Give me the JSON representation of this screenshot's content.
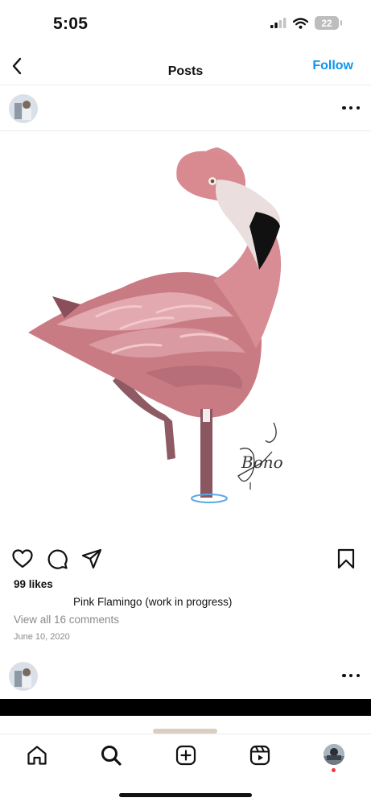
{
  "status_bar": {
    "time": "5:05",
    "battery_level": "22",
    "icons": [
      "cellular-signal-icon",
      "wifi-icon",
      "battery-icon"
    ]
  },
  "nav": {
    "back_icon": "chevron-left-icon",
    "title": "Posts",
    "follow_label": "Follow",
    "follow_color": "#0a95f0"
  },
  "post": {
    "author_avatar": "avatar",
    "more_icon": "more-horizontal-icon",
    "image_subject": "flamingo-painting",
    "signature": "Bono",
    "actions": [
      "heart-icon",
      "comment-icon",
      "share-icon",
      "bookmark-icon"
    ],
    "likes": "99 likes",
    "caption": "Pink Flamingo (work in progress)",
    "view_comments": "View all 16 comments",
    "date": "June 10, 2020"
  },
  "next_post": {
    "author_avatar": "avatar",
    "more_icon": "more-horizontal-icon"
  },
  "tab_bar": {
    "items": [
      "home-icon",
      "search-icon",
      "create-icon",
      "reels-icon",
      "profile-avatar"
    ],
    "notification_dot_color": "#ff3040"
  }
}
